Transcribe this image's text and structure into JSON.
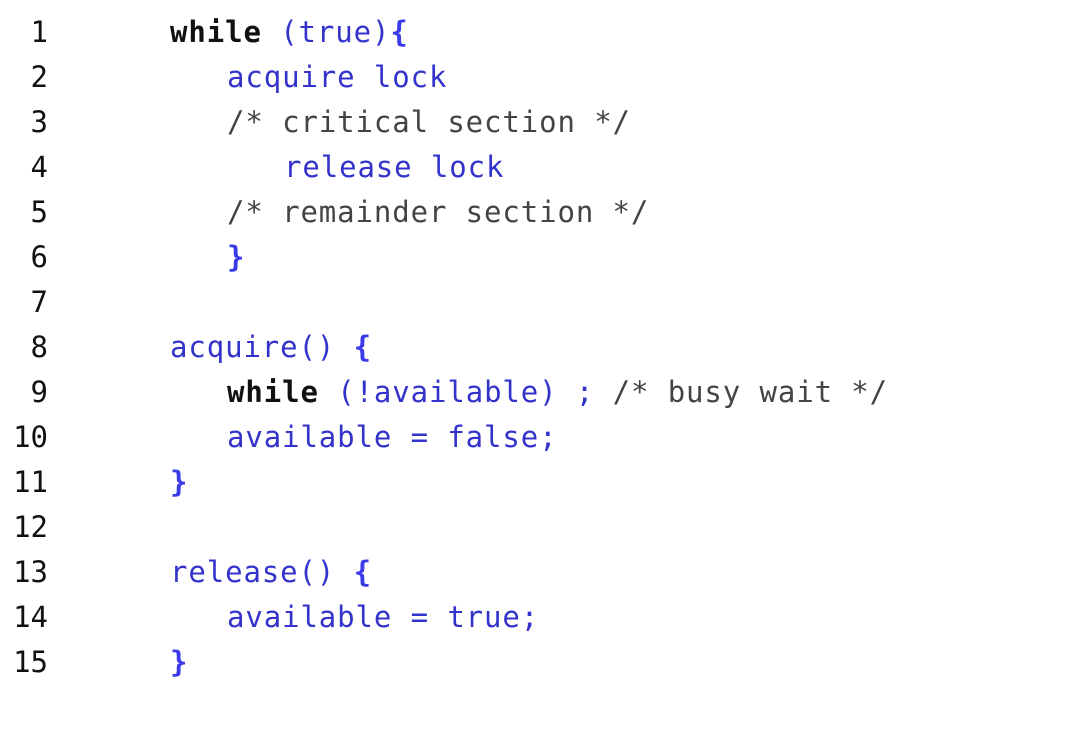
{
  "listing": {
    "language": "pseudocode",
    "description": "Mutex lock busy-waiting (spinlock) pseudocode listing",
    "colors": {
      "background": "#ffffff",
      "code_blue": "#3333cc",
      "brace_blue": "#3a3ae8",
      "comment_gray": "#444444",
      "keyword_black": "#111111",
      "line_number": "#111111"
    },
    "lines": [
      {
        "number": "1",
        "indent": 0,
        "text": "while (true){",
        "tokens": [
          {
            "text": "while",
            "style": "keyword"
          },
          {
            "text": " ",
            "style": "plain"
          },
          {
            "text": "(true)",
            "style": "code"
          },
          {
            "text": "{",
            "style": "brace"
          }
        ]
      },
      {
        "number": "2",
        "indent": 3,
        "text": "acquire lock",
        "tokens": [
          {
            "text": "acquire lock",
            "style": "code"
          }
        ]
      },
      {
        "number": "3",
        "indent": 3,
        "text": "/* critical section */",
        "tokens": [
          {
            "text": "/* critical section */",
            "style": "comment"
          }
        ]
      },
      {
        "number": "4",
        "indent": 6,
        "text": "release lock",
        "tokens": [
          {
            "text": "release lock",
            "style": "code"
          }
        ]
      },
      {
        "number": "5",
        "indent": 3,
        "text": "/* remainder section */",
        "tokens": [
          {
            "text": "/* remainder section */",
            "style": "comment"
          }
        ]
      },
      {
        "number": "6",
        "indent": 3,
        "text": "}",
        "tokens": [
          {
            "text": "}",
            "style": "brace"
          }
        ]
      },
      {
        "number": "7",
        "indent": 0,
        "text": "",
        "tokens": []
      },
      {
        "number": "8",
        "indent": 0,
        "text": "acquire() {",
        "tokens": [
          {
            "text": "acquire() ",
            "style": "code"
          },
          {
            "text": "{",
            "style": "brace"
          }
        ]
      },
      {
        "number": "9",
        "indent": 3,
        "text": "while (!available) ; /* busy wait */",
        "tokens": [
          {
            "text": "while",
            "style": "keyword"
          },
          {
            "text": " ",
            "style": "plain"
          },
          {
            "text": "(!available) ;",
            "style": "code"
          },
          {
            "text": " ",
            "style": "plain"
          },
          {
            "text": "/* busy wait */",
            "style": "comment"
          }
        ]
      },
      {
        "number": "10",
        "indent": 3,
        "text": "available = false;",
        "tokens": [
          {
            "text": "available = false;",
            "style": "code"
          }
        ]
      },
      {
        "number": "11",
        "indent": 0,
        "text": "}",
        "tokens": [
          {
            "text": "}",
            "style": "brace"
          }
        ]
      },
      {
        "number": "12",
        "indent": 0,
        "text": "",
        "tokens": []
      },
      {
        "number": "13",
        "indent": 0,
        "text": "release() {",
        "tokens": [
          {
            "text": "release() ",
            "style": "code"
          },
          {
            "text": "{",
            "style": "brace"
          }
        ]
      },
      {
        "number": "14",
        "indent": 3,
        "text": "available = true;",
        "tokens": [
          {
            "text": "available = true;",
            "style": "code"
          }
        ]
      },
      {
        "number": "15",
        "indent": 0,
        "text": "}",
        "tokens": [
          {
            "text": "}",
            "style": "brace"
          }
        ]
      }
    ]
  }
}
